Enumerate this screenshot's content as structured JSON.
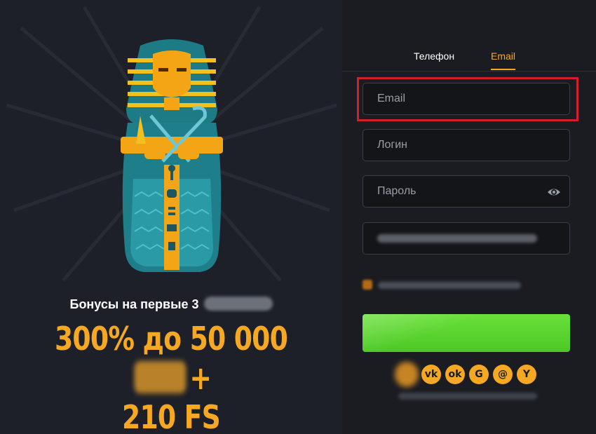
{
  "tabs": {
    "phone": "Телефон",
    "email": "Email"
  },
  "fields": {
    "email_placeholder": "Email",
    "login_placeholder": "Логин",
    "password_placeholder": "Пароль"
  },
  "promo": {
    "bonus_line": "Бонусы на первые 3",
    "offer_line1_a": "300% до 50 000",
    "offer_line1_b": "+",
    "offer_line2": "210 FS"
  },
  "socials": [
    {
      "icon": "vk-icon",
      "glyph": "vk"
    },
    {
      "icon": "odnoklassniki-icon",
      "glyph": "ok"
    },
    {
      "icon": "google-icon",
      "glyph": "G"
    },
    {
      "icon": "mail-icon",
      "glyph": "@"
    },
    {
      "icon": "yandex-icon",
      "glyph": "Y"
    }
  ],
  "colors": {
    "accent": "#f6a823",
    "highlight": "#d1202a",
    "submit": "#5dd42f",
    "bg": "#1a1c22"
  }
}
